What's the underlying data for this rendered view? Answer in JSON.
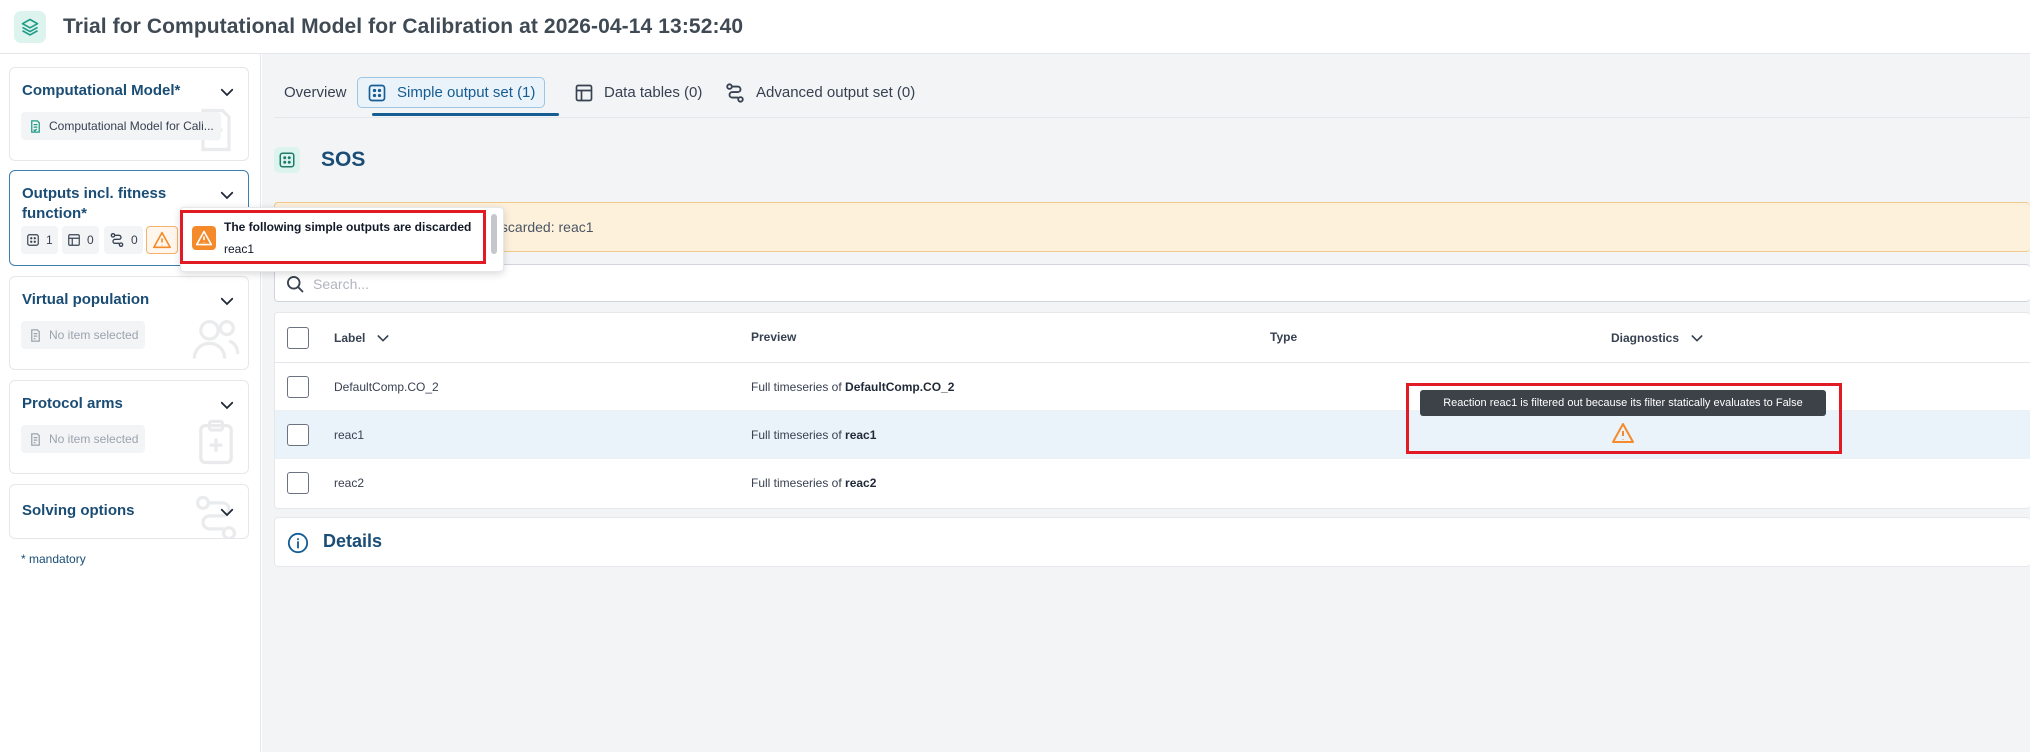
{
  "header": {
    "title": "Trial for Computational Model for Calibration at 2026-04-14 13:52:40",
    "logo_icon": "layers-icon"
  },
  "sidebar": {
    "computational_model": {
      "title": "Computational Model*",
      "item": "Computational Model for Cali..."
    },
    "outputs": {
      "title": "Outputs incl. fitness function*",
      "simple_count": "1",
      "table_count": "0",
      "advanced_count": "0"
    },
    "virtual_population": {
      "title": "Virtual population",
      "placeholder": "No item selected"
    },
    "protocol_arms": {
      "title": "Protocol arms",
      "placeholder": "No item selected"
    },
    "solving_options": {
      "title": "Solving options"
    },
    "mandatory_note": "* mandatory"
  },
  "tabs": [
    {
      "label": "Overview"
    },
    {
      "label": "Simple output set (1)"
    },
    {
      "label": "Data tables (0)"
    },
    {
      "label": "Advanced output set (0)"
    }
  ],
  "section": {
    "title": "SOS"
  },
  "banner": {
    "text": "s are discarded: reac1"
  },
  "search": {
    "placeholder": "Search..."
  },
  "table": {
    "headers": {
      "label": "Label",
      "preview": "Preview",
      "type": "Type",
      "diagnostics": "Diagnostics"
    },
    "rows": [
      {
        "label": "DefaultComp.CO_2",
        "preview_prefix": "Full timeseries of ",
        "preview_name": "DefaultComp.CO_2"
      },
      {
        "label": "reac1",
        "preview_prefix": "Full timeseries of ",
        "preview_name": "reac1"
      },
      {
        "label": "reac2",
        "preview_prefix": "Full timeseries of ",
        "preview_name": "reac2"
      }
    ]
  },
  "details": {
    "title": "Details"
  },
  "popover": {
    "title": "The following simple outputs are discarded",
    "item": "reac1"
  },
  "diagnostic_tooltip": {
    "text": "Reaction reac1 is filtered out because its filter statically evaluates to False"
  },
  "colors": {
    "brand": "#1a4d75",
    "accent": "#155d93",
    "warning": "#f58a2a",
    "highlight": "#e01b24"
  }
}
